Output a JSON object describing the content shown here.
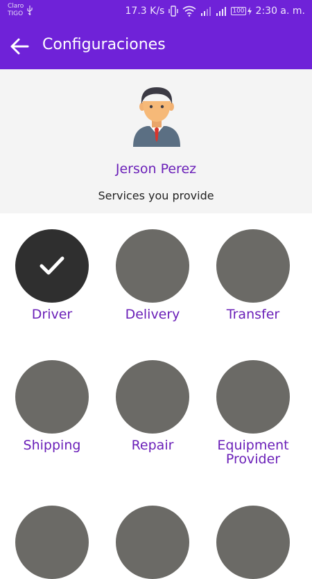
{
  "status_bar": {
    "carrier_line1": "Claro",
    "carrier_line2": "TIGO",
    "speed": "17.3 K/s",
    "battery": "100",
    "time": "2:30 a. m."
  },
  "appbar": {
    "title": "Configuraciones",
    "back_icon": "arrow-left-icon"
  },
  "profile": {
    "name": "Jerson Perez",
    "subtitle": "Services you provide",
    "avatar_icon": "businessman-avatar-icon"
  },
  "services": [
    {
      "label": "Driver",
      "selected": true
    },
    {
      "label": "Delivery",
      "selected": false
    },
    {
      "label": "Transfer",
      "selected": false
    },
    {
      "label": "Shipping",
      "selected": false
    },
    {
      "label": "Repair",
      "selected": false
    },
    {
      "label": "Equipment Provider",
      "selected": false
    },
    {
      "label": "",
      "selected": false
    },
    {
      "label": "",
      "selected": false
    },
    {
      "label": "",
      "selected": false
    }
  ],
  "colors": {
    "primary": "#6f22d8",
    "accent_text": "#6a1fb8",
    "circle": "#6b6a66",
    "circle_selected": "#2f2f2f"
  }
}
